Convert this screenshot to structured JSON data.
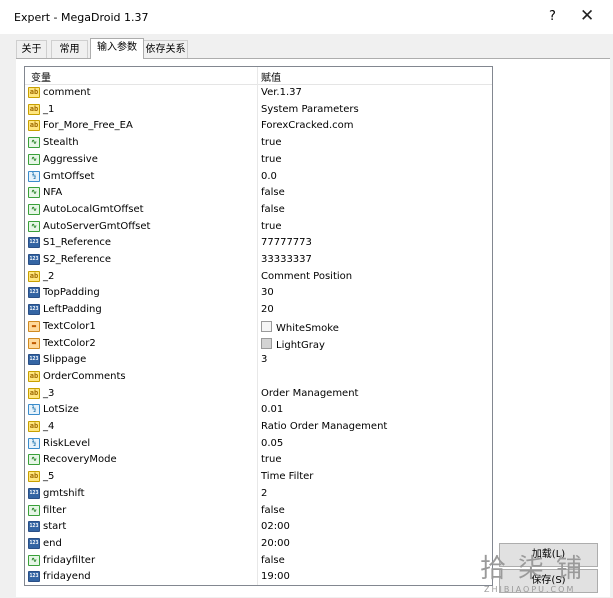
{
  "window": {
    "title": "Expert - MegaDroid 1.37",
    "help": "?",
    "close": "✕"
  },
  "tabs": [
    "关于",
    "常用",
    "输入参数",
    "依存关系"
  ],
  "table": {
    "headers": {
      "variable": "变量",
      "value": "赋值"
    },
    "rows": [
      {
        "type": "ab",
        "name": "comment",
        "value": "Ver.1.37"
      },
      {
        "type": "ab",
        "name": "_1",
        "value": "System Parameters"
      },
      {
        "type": "ab",
        "name": "For_More_Free_EA",
        "value": "ForexCracked.com"
      },
      {
        "type": "bool",
        "name": "Stealth",
        "value": "true"
      },
      {
        "type": "bool",
        "name": "Aggressive",
        "value": "true"
      },
      {
        "type": "dbl",
        "name": "GmtOffset",
        "value": "0.0"
      },
      {
        "type": "bool",
        "name": "NFA",
        "value": "false"
      },
      {
        "type": "bool",
        "name": "AutoLocalGmtOffset",
        "value": "false"
      },
      {
        "type": "bool",
        "name": "AutoServerGmtOffset",
        "value": "true"
      },
      {
        "type": "int",
        "name": "S1_Reference",
        "value": "77777773"
      },
      {
        "type": "int",
        "name": "S2_Reference",
        "value": "33333337"
      },
      {
        "type": "ab",
        "name": "_2",
        "value": "Comment Position"
      },
      {
        "type": "int",
        "name": "TopPadding",
        "value": "30"
      },
      {
        "type": "int",
        "name": "LeftPadding",
        "value": "20"
      },
      {
        "type": "color",
        "name": "TextColor1",
        "value": "WhiteSmoke",
        "swatch": "#f5f5f5"
      },
      {
        "type": "color",
        "name": "TextColor2",
        "value": "LightGray",
        "swatch": "#d3d3d3"
      },
      {
        "type": "int",
        "name": "Slippage",
        "value": "3"
      },
      {
        "type": "ab",
        "name": "OrderComments",
        "value": ""
      },
      {
        "type": "ab",
        "name": "_3",
        "value": "Order Management"
      },
      {
        "type": "dbl",
        "name": "LotSize",
        "value": "0.01"
      },
      {
        "type": "ab",
        "name": "_4",
        "value": "Ratio Order Management"
      },
      {
        "type": "dbl",
        "name": "RiskLevel",
        "value": "0.05"
      },
      {
        "type": "bool",
        "name": "RecoveryMode",
        "value": "true"
      },
      {
        "type": "ab",
        "name": "_5",
        "value": "Time Filter"
      },
      {
        "type": "int",
        "name": "gmtshift",
        "value": "2"
      },
      {
        "type": "bool",
        "name": "filter",
        "value": "false"
      },
      {
        "type": "int",
        "name": "start",
        "value": "02:00"
      },
      {
        "type": "int",
        "name": "end",
        "value": "20:00"
      },
      {
        "type": "bool",
        "name": "fridayfilter",
        "value": "false"
      },
      {
        "type": "int",
        "name": "fridayend",
        "value": "19:00"
      }
    ]
  },
  "buttons": {
    "load": "加载(L)",
    "save": "保存(S)"
  },
  "watermark": {
    "chars": "拾柒铺",
    "sub": "ZHIBIAOPU.COM"
  },
  "icons": {
    "ab": {
      "label": "ab",
      "color": "#a06a00",
      "bg": "#ffe680",
      "border": "#c8a000"
    },
    "bool": {
      "label": "∿",
      "color": "#1b7d1b",
      "bg": "#e6f6e6",
      "border": "#3aa03a"
    },
    "dbl": {
      "label": "½",
      "color": "#0c6aa8",
      "bg": "#e6f2fb",
      "border": "#3a8ccc"
    },
    "int": {
      "label": "123",
      "color": "#ffffff",
      "bg": "#3465a4",
      "border": "#2a4f86"
    },
    "color": {
      "label": "▬",
      "color": "#c05a00",
      "bg": "#ffd99a",
      "border": "#d08a20"
    }
  }
}
